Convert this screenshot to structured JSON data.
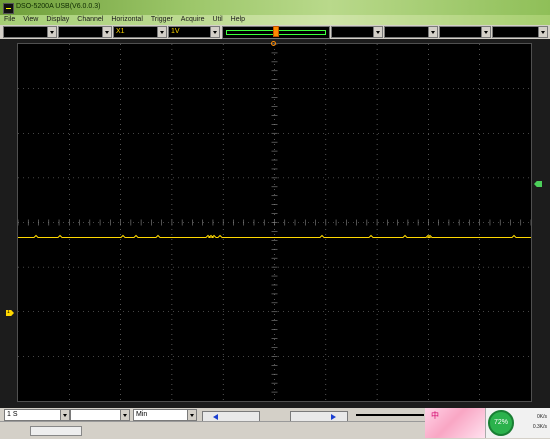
{
  "window": {
    "title": "DSO-5200A USB(V6.0.0.3)"
  },
  "menu": [
    "File",
    "View",
    "Display",
    "Channel",
    "Horizontal",
    "Trigger",
    "Acquire",
    "Util",
    "Help"
  ],
  "controls": {
    "probe": "X1",
    "volts_div": "1V"
  },
  "bottom": {
    "time_div": "1 S",
    "time_unit": "Min"
  },
  "overlay": {
    "ad_text": "中"
  },
  "network": {
    "percent": "72%",
    "down": "0K/s",
    "up": "0.3K/s"
  },
  "colors": {
    "ch1": "#ffd800",
    "grid": "#8a8a8a",
    "trigger_marker": "#ff8a00",
    "trigger_level": "#4cd05a"
  }
}
